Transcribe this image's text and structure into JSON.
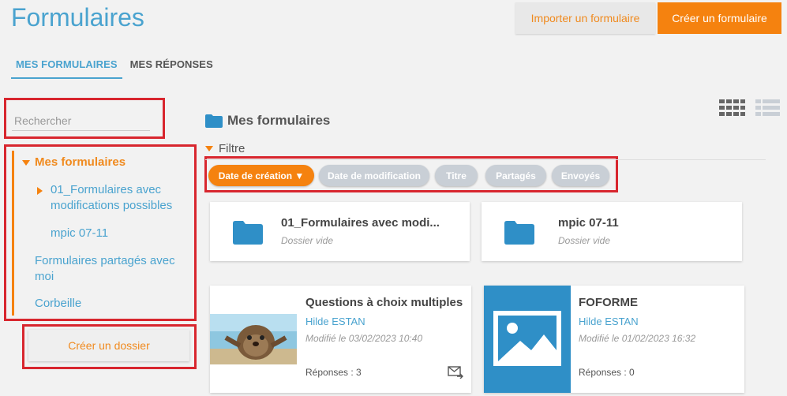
{
  "header": {
    "title": "Formulaires",
    "import_label": "Importer un formulaire",
    "create_label": "Créer un formulaire"
  },
  "tabs": [
    {
      "label": "MES FORMULAIRES",
      "active": true
    },
    {
      "label": "MES RÉPONSES",
      "active": false
    }
  ],
  "sidebar": {
    "search_placeholder": "Rechercher",
    "tree": {
      "root": "Mes formulaires",
      "children": [
        "01_Formulaires avec modifications possibles",
        "mpic 07-11"
      ],
      "shared": "Formulaires partagés avec moi",
      "trash": "Corbeille"
    },
    "create_folder_label": "Créer un dossier"
  },
  "main": {
    "section_title": "Mes formulaires",
    "filter_label": "Filtre",
    "filters": [
      {
        "label": "Date de création ▼",
        "active": true
      },
      {
        "label": "Date de modification",
        "active": false
      },
      {
        "label": "Titre",
        "active": false
      },
      {
        "label": "Partagés",
        "active": false
      },
      {
        "label": "Envoyés",
        "active": false
      }
    ],
    "folders": [
      {
        "title": "01_Formulaires avec modi...",
        "status": "Dossier vide"
      },
      {
        "title": "mpic 07-11",
        "status": "Dossier vide"
      }
    ],
    "forms": [
      {
        "title": "Questions à choix multiples",
        "author": "Hilde ESTAN",
        "modified": "Modifié le 03/02/2023 10:40",
        "responses": "Réponses : 3",
        "thumbnail": "photo-quokka",
        "sent": true
      },
      {
        "title": "FOFORME",
        "author": "Hilde ESTAN",
        "modified": "Modifié le 01/02/2023 16:32",
        "responses": "Réponses : 0",
        "thumbnail": "image-placeholder-icon",
        "sent": false
      }
    ]
  },
  "colors": {
    "accent_blue": "#4aa3cf",
    "accent_orange": "#f5820f",
    "highlight_red": "#d8262e",
    "chip_inactive": "#c9cfd6"
  }
}
